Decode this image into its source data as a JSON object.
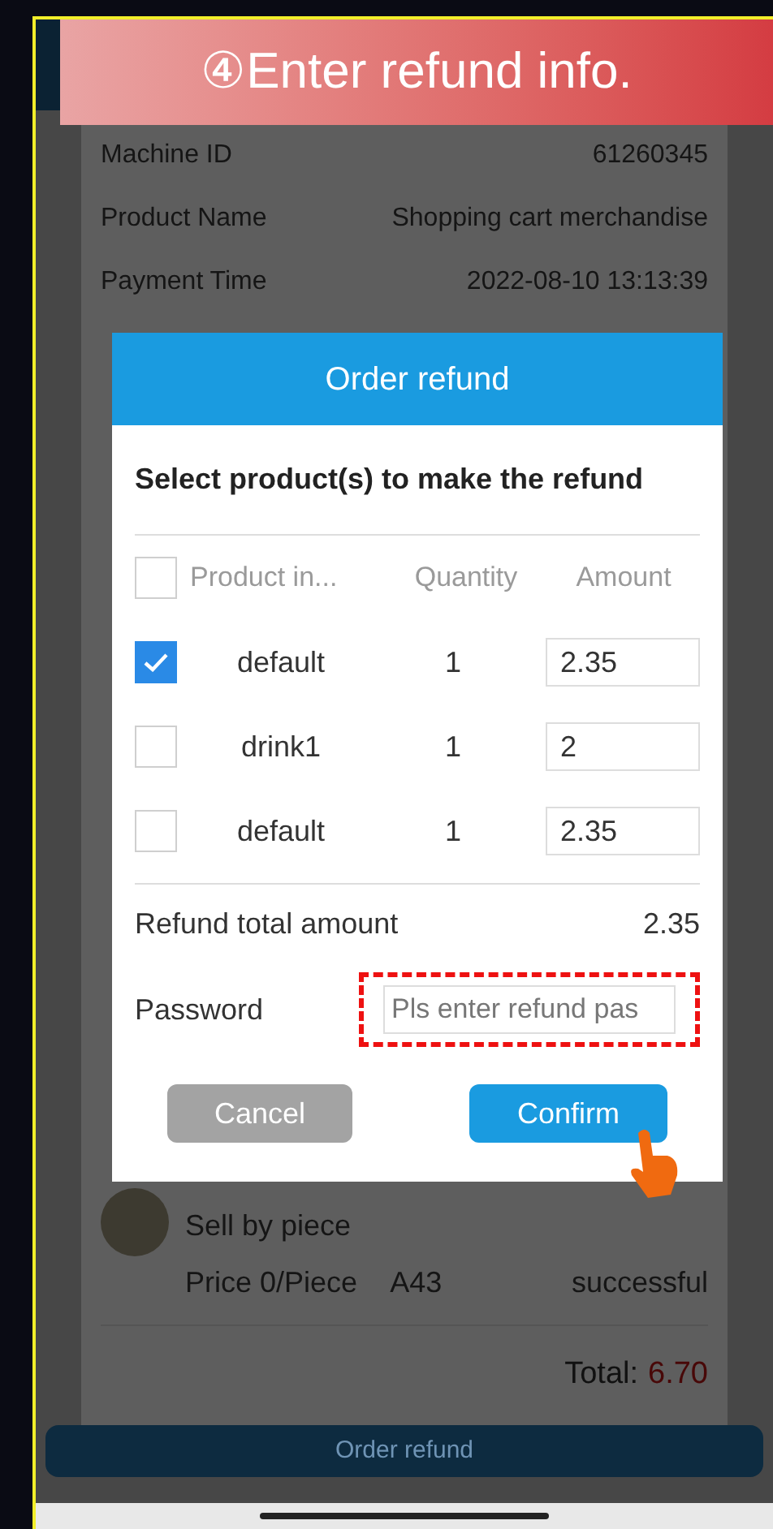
{
  "banner": {
    "title": "④Enter refund info."
  },
  "details": [
    {
      "label": "Machine ID",
      "value": "61260345"
    },
    {
      "label": "Product Name",
      "value": "Shopping cart merchandise"
    },
    {
      "label": "Payment Time",
      "value": "2022-08-10 13:13:39"
    }
  ],
  "product": {
    "sell_mode": "Sell by piece",
    "price": "Price 0/Piece",
    "slot": "A43",
    "status": "successful"
  },
  "total": {
    "label": "Total:",
    "value": "6.70"
  },
  "order_refund_button": "Order refund",
  "dialog": {
    "title": "Order refund",
    "subtitle": "Select product(s) to make the refund",
    "columns": [
      "Product in...",
      "Quantity",
      "Amount"
    ],
    "select_all_checked": false,
    "rows": [
      {
        "name": "default",
        "quantity": "1",
        "amount": "2.35",
        "checked": true
      },
      {
        "name": "drink1",
        "quantity": "1",
        "amount": "2",
        "checked": false
      },
      {
        "name": "default",
        "quantity": "1",
        "amount": "2.35",
        "checked": false
      }
    ],
    "total_label": "Refund total amount",
    "total_value": "2.35",
    "password_label": "Password",
    "password_placeholder": "Pls enter refund pas",
    "cancel": "Cancel",
    "confirm": "Confirm"
  }
}
